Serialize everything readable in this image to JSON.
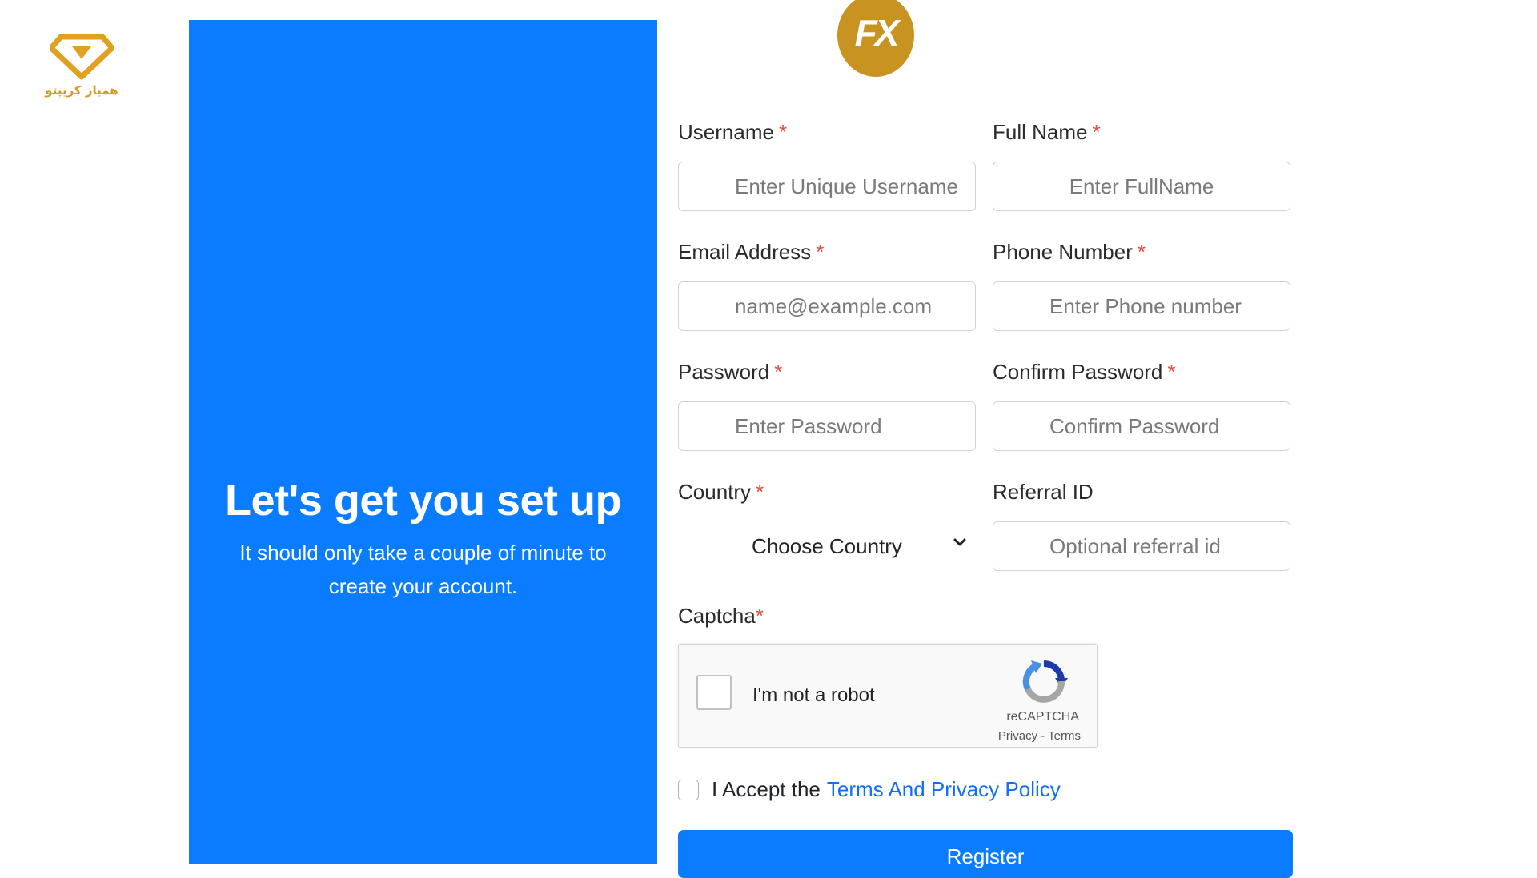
{
  "watermark": {
    "text": "همیار کریپتو"
  },
  "logo": {
    "text": "FX"
  },
  "hero": {
    "title": "Let's get you set up",
    "subtitle": "It should only take a couple of minute to create your account."
  },
  "form": {
    "username": {
      "label": "Username",
      "placeholder": "Enter Unique Username"
    },
    "fullname": {
      "label": "Full Name",
      "placeholder": "Enter FullName"
    },
    "email": {
      "label": "Email Address",
      "placeholder": "name@example.com"
    },
    "phone": {
      "label": "Phone Number",
      "placeholder": "Enter Phone number"
    },
    "password": {
      "label": "Password",
      "placeholder": "Enter Password"
    },
    "confirm": {
      "label": "Confirm Password",
      "placeholder": "Confirm Password"
    },
    "country": {
      "label": "Country",
      "selected": "Choose Country"
    },
    "referral": {
      "label": "Referral ID",
      "placeholder": "Optional referral id"
    },
    "required_mark": "*"
  },
  "captcha": {
    "label": "Captcha",
    "checkbox_text": "I'm not a robot",
    "brand": "reCAPTCHA",
    "links": "Privacy - Terms"
  },
  "terms": {
    "prefix": "I Accept the",
    "link": "Terms And Privacy Policy"
  },
  "register": {
    "label": "Register"
  },
  "colors": {
    "primary": "#0a7cff",
    "required": "#e74c3c",
    "logo_gold": "#c99322"
  }
}
